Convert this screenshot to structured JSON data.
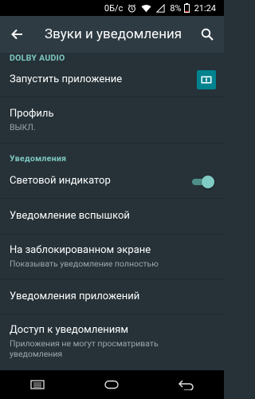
{
  "status_bar": {
    "data_speed": "0Б/с",
    "battery": "8%",
    "time": "21:24"
  },
  "app_bar": {
    "title": "Звуки и уведомления"
  },
  "sections": {
    "dolby": {
      "header": "DOLBY AUDIO",
      "launch_app": "Запустить приложение",
      "profile_title": "Профиль",
      "profile_value": "ВЫКЛ."
    },
    "notifications": {
      "header": "Уведомления",
      "light_indicator": "Световой индикатор",
      "light_indicator_on": true,
      "flash_notification": "Уведомление вспышкой",
      "lock_screen_title": "На заблокированном экране",
      "lock_screen_value": "Показывать уведомление полностью",
      "app_notifications": "Уведомления приложений",
      "access_title": "Доступ к уведомлениям",
      "access_value": "Приложения не могут просматривать уведомления"
    }
  },
  "colors": {
    "accent": "#80cbc4",
    "background": "#263238",
    "app_bar": "#2e3b42"
  }
}
